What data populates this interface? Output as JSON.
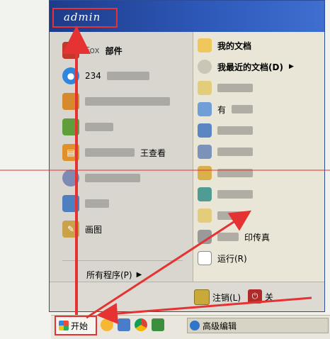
{
  "user": {
    "name": "admin"
  },
  "left_items": [
    {
      "label": "部件",
      "prefix": "Fox",
      "icon": "foxmail-icon",
      "color": "#c0392b"
    },
    {
      "label": "234",
      "icon": "qq-icon",
      "color": "#2e86de"
    },
    {
      "label": "",
      "icon": "app-icon",
      "color": "#d48a2d"
    },
    {
      "label": "",
      "icon": "game-icon",
      "color": "#5f9e3b"
    },
    {
      "label": "王查看",
      "icon": "viewer-icon",
      "color": "#e0912b"
    },
    {
      "label": "",
      "icon": "media-icon",
      "color": "#7d8bb3"
    },
    {
      "label": "",
      "icon": "app-icon",
      "color": "#4e7fbf"
    },
    {
      "label": "画图",
      "icon": "paint-icon",
      "color": "#c9a24a"
    }
  ],
  "all_programs": "所有程序(P)",
  "right_items": [
    {
      "label": "我的文档",
      "icon": "folder-icon",
      "bold": true
    },
    {
      "label": "我最近的文档(D)",
      "icon": "recent-docs-icon",
      "bold": true,
      "arrow": "▶"
    },
    {
      "label": "",
      "icon": "folder-icon"
    },
    {
      "label": "有",
      "icon": "pictures-icon"
    },
    {
      "label": "",
      "icon": "computer-icon"
    },
    {
      "label": "",
      "icon": "network-icon"
    },
    {
      "label": "",
      "icon": "control-panel-icon"
    },
    {
      "label": "",
      "icon": "settings-icon"
    },
    {
      "label": "",
      "icon": "app-icon"
    },
    {
      "label": "印传真",
      "icon": "printer-icon"
    },
    {
      "label": "运行(R)",
      "icon": "run-icon"
    }
  ],
  "bottom": {
    "logoff": "注销(L)",
    "shutdown": "关"
  },
  "taskbar": {
    "start_label": "开始",
    "window_label": "高级编辑"
  }
}
